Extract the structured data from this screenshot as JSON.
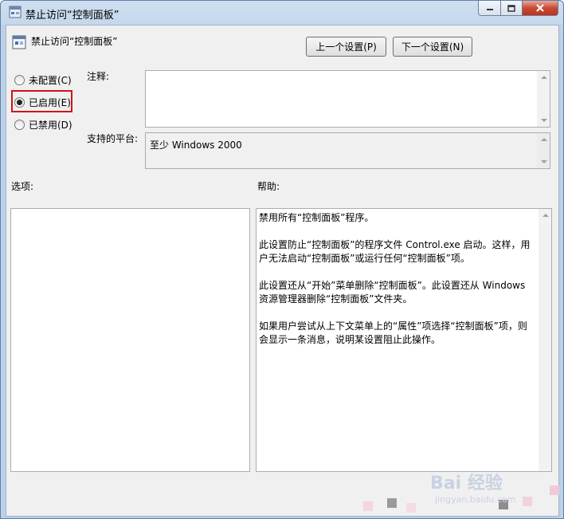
{
  "window": {
    "title": "禁止访问“控制面板”"
  },
  "header": {
    "policy_name": "禁止访问“控制面板”",
    "prev_button": "上一个设置(P)",
    "next_button": "下一个设置(N)"
  },
  "state": {
    "options": [
      {
        "label": "未配置(C)",
        "selected": false
      },
      {
        "label": "已启用(E)",
        "selected": true
      },
      {
        "label": "已禁用(D)",
        "selected": false
      }
    ]
  },
  "comment": {
    "label": "注释:",
    "value": ""
  },
  "platform": {
    "label": "支持的平台:",
    "value": "至少 Windows 2000"
  },
  "options_section": {
    "label": "选项:"
  },
  "help_section": {
    "label": "帮助:",
    "paragraphs": [
      "禁用所有“控制面板”程序。",
      "此设置防止“控制面板”的程序文件 Control.exe 启动。这样，用户无法启动“控制面板”或运行任何“控制面板”项。",
      "此设置还从“开始”菜单删除“控制面板”。此设置还从 Windows 资源管理器删除“控制面板”文件夹。",
      "如果用户尝试从上下文菜单上的“属性”项选择“控制面板”项，则会显示一条消息，说明某设置阻止此操作。"
    ]
  },
  "watermark": {
    "logo": "Bai 经验",
    "url": "jingyan.baidu.com"
  },
  "colors": {
    "highlight_box": "#d0121b",
    "title_gradient": "#c4d7ec",
    "client_bg": "#f0f0f0"
  },
  "icons": [
    "policy-icon",
    "minimize-icon",
    "maximize-icon",
    "close-icon"
  ]
}
